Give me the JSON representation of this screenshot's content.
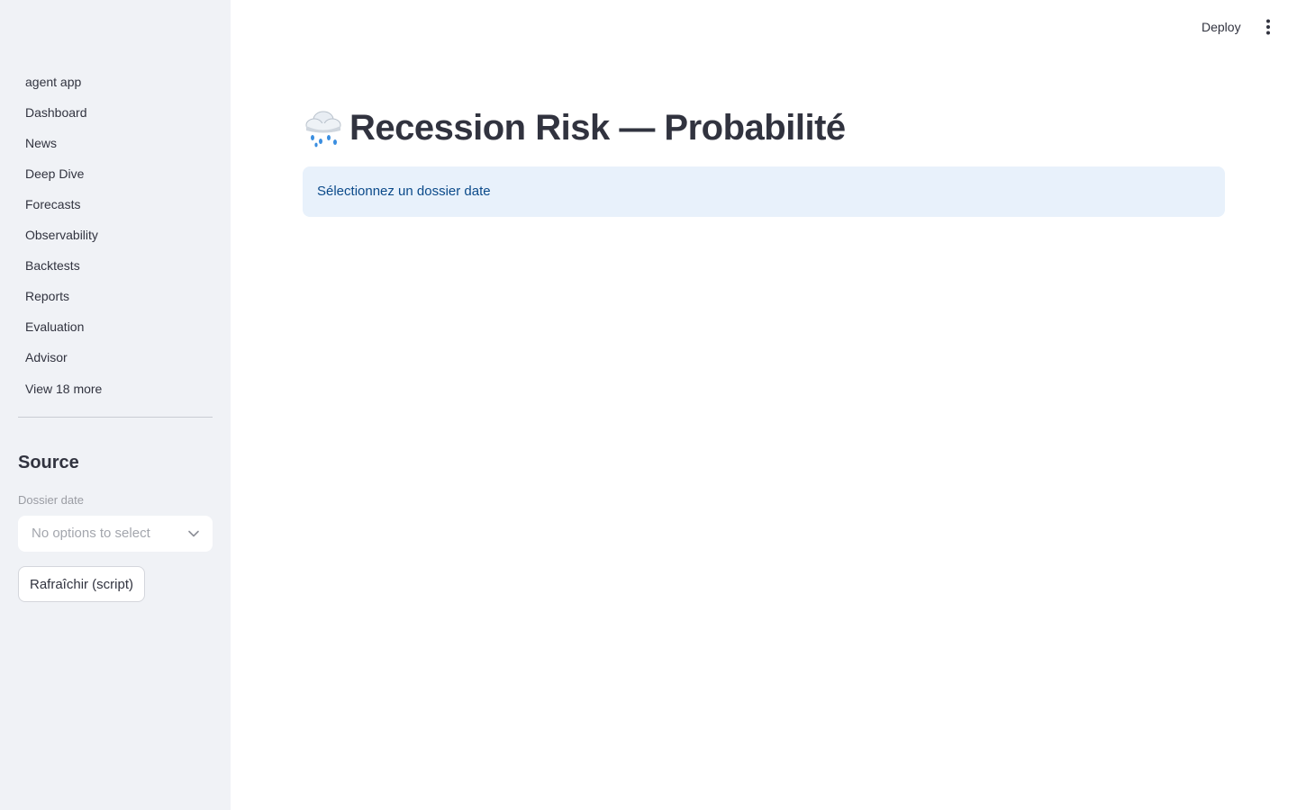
{
  "topbar": {
    "deploy_label": "Deploy",
    "menu_icon": "more-vertical-icon"
  },
  "sidebar": {
    "nav_items": [
      {
        "label": "agent app"
      },
      {
        "label": "Dashboard"
      },
      {
        "label": "News"
      },
      {
        "label": "Deep Dive"
      },
      {
        "label": "Forecasts"
      },
      {
        "label": "Observability"
      },
      {
        "label": "Backtests"
      },
      {
        "label": "Reports"
      },
      {
        "label": "Evaluation"
      },
      {
        "label": "Advisor"
      }
    ],
    "view_more_label": "View 18 more",
    "source": {
      "heading": "Source",
      "date_label": "Dossier date",
      "date_value": "No options to select",
      "refresh_label": "Rafraîchir (script)"
    }
  },
  "main": {
    "title_icon": "rain-cloud-icon",
    "title": "Recession Risk — Probabilité",
    "info_message": "Sélectionnez un dossier date"
  },
  "colors": {
    "sidebar_bg": "#f0f2f6",
    "text": "#31333f",
    "info_bg": "#e8f1fb",
    "info_text": "#0b4a8a"
  }
}
